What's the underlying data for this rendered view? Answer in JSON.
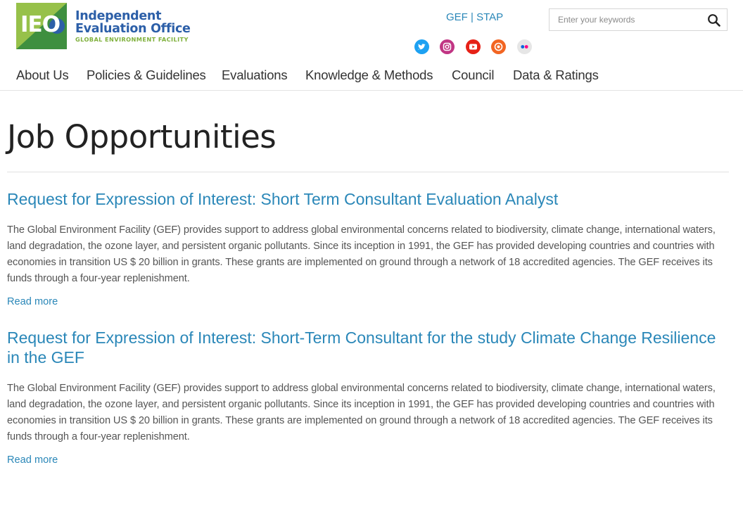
{
  "header": {
    "logo": {
      "letters": "IEO",
      "line1": "Independent",
      "line2": "Evaluation Office",
      "line3": "GLOBAL ENVIRONMENT FACILITY",
      "colors": {
        "green": "#8cb83e",
        "dark_green": "#2f7a3a",
        "blue": "#2c5fa8"
      }
    },
    "top_links": {
      "gef": "GEF",
      "separator": "|",
      "stap": "STAP"
    },
    "search": {
      "placeholder": "Enter your keywords",
      "value": "",
      "icon": "search-icon"
    },
    "social": [
      {
        "name": "twitter-icon",
        "color": "#1da1f2"
      },
      {
        "name": "instagram-icon",
        "color": "#c13584"
      },
      {
        "name": "youtube-icon",
        "color": "#e62117"
      },
      {
        "name": "rss-icon",
        "color": "#f26522"
      },
      {
        "name": "flickr-icon",
        "color": "#e6e6e6"
      }
    ]
  },
  "nav": {
    "items": [
      "About Us",
      "Policies & Guidelines",
      "Evaluations",
      "Knowledge & Methods",
      "Council",
      "Data & Ratings"
    ]
  },
  "main": {
    "title": "Job Opportunities",
    "jobs": [
      {
        "title": "Request for Expression of Interest: Short Term Consultant Evaluation Analyst",
        "body": "The Global Environment Facility (GEF) provides support to address global environmental concerns related to biodiversity, climate change, international waters, land degradation, the ozone layer, and persistent organic pollutants. Since its inception in 1991, the GEF has provided developing countries and countries with economies in transition US $ 20 billion in grants. These grants are implemented on ground through a network of 18 accredited agencies. The GEF receives its funds through a four-year replenishment.",
        "read_more": "Read more"
      },
      {
        "title": "Request for Expression of Interest: Short-Term Consultant for the study Climate Change Resilience in the GEF",
        "body": "The Global Environment Facility (GEF) provides support to address global environmental concerns related to biodiversity, climate change, international waters, land degradation, the ozone layer, and persistent organic pollutants. Since its inception in 1991, the GEF has provided developing countries and countries with economies in transition US $ 20 billion in grants. These grants are implemented on ground through a network of 18 accredited agencies. The GEF receives its funds through a four-year replenishment.",
        "read_more": "Read more"
      }
    ]
  },
  "colors": {
    "link": "#2a87b8",
    "text": "#555555",
    "heading": "#222222"
  }
}
